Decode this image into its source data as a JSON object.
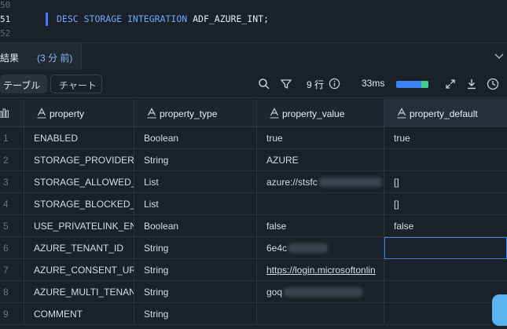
{
  "editor": {
    "line_numbers": [
      "50",
      "51",
      "52"
    ],
    "active_line": "51",
    "code_keywords": "DESC STORAGE INTEGRATION",
    "code_identifier": " ADF_AZURE_INT;"
  },
  "results_tab": {
    "label": "結果",
    "time": "(3 分 前)"
  },
  "toolbar": {
    "table_tab": "テーブル",
    "chart_tab": "チャート",
    "row_count": "9 行",
    "duration": "33ms",
    "progress_percent": 100
  },
  "table": {
    "columns": [
      "property",
      "property_type",
      "property_value",
      "property_default"
    ],
    "rows": [
      {
        "n": "1",
        "property": "ENABLED",
        "type": "Boolean",
        "value": "true",
        "default": "true"
      },
      {
        "n": "2",
        "property": "STORAGE_PROVIDER",
        "type": "String",
        "value": "AZURE",
        "default": ""
      },
      {
        "n": "3",
        "property": "STORAGE_ALLOWED_L",
        "type": "List",
        "value": "azure://stsfc",
        "default": "[]"
      },
      {
        "n": "4",
        "property": "STORAGE_BLOCKED_L",
        "type": "List",
        "value": "",
        "default": "[]"
      },
      {
        "n": "5",
        "property": "USE_PRIVATELINK_EN",
        "type": "Boolean",
        "value": "false",
        "default": "false"
      },
      {
        "n": "6",
        "property": "AZURE_TENANT_ID",
        "type": "String",
        "value": "6e4c",
        "default": ""
      },
      {
        "n": "7",
        "property": "AZURE_CONSENT_URI",
        "type": "String",
        "value": "https://login.microsoftonlin",
        "default": ""
      },
      {
        "n": "8",
        "property": "AZURE_MULTI_TENAN",
        "type": "String",
        "value": "goq",
        "default": ""
      },
      {
        "n": "9",
        "property": "COMMENT",
        "type": "String",
        "value": "",
        "default": ""
      }
    ]
  },
  "colors": {
    "accent": "#3b82f6",
    "progress_end": "#3ecf8e",
    "background": "#1b2129"
  }
}
